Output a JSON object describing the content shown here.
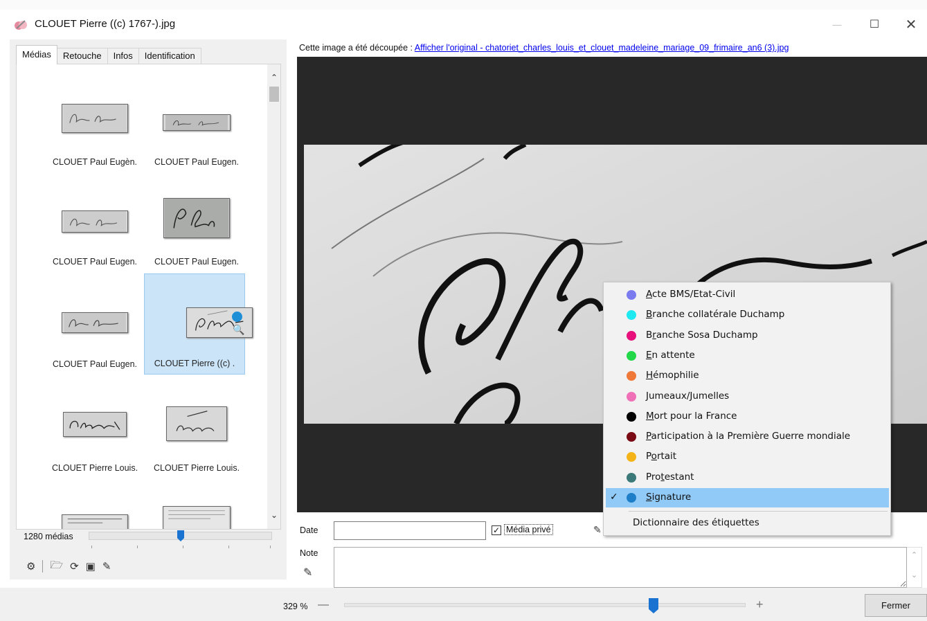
{
  "window": {
    "title": "CLOUET Pierre ((c) 1767-).jpg",
    "minimize_glyph": "—",
    "maximize_glyph": "☐",
    "close_glyph": "✕"
  },
  "tabs": [
    {
      "label": "Médias",
      "active": true
    },
    {
      "label": "Retouche",
      "active": false
    },
    {
      "label": "Infos",
      "active": false
    },
    {
      "label": "Identification",
      "active": false
    }
  ],
  "media_grid": {
    "items": [
      {
        "label": "CLOUET Paul Eugèn.",
        "selected": false
      },
      {
        "label": "CLOUET Paul Eugen.",
        "selected": false
      },
      {
        "label": "CLOUET Paul Eugen.",
        "selected": false
      },
      {
        "label": "CLOUET Paul Eugen.",
        "selected": false
      },
      {
        "label": "CLOUET Paul Eugen.",
        "selected": false
      },
      {
        "label": "CLOUET Pierre ((c) .",
        "selected": true
      },
      {
        "label": "CLOUET Pierre Louis.",
        "selected": false
      },
      {
        "label": "CLOUET Pierre Louis.",
        "selected": false
      }
    ],
    "selected_tag_color": "#1e8fd6"
  },
  "media_count": "1280 médias",
  "thumb_size_fraction": 0.5,
  "left_toolbar": {
    "icons": [
      "settings-icon",
      "folder-icon",
      "refresh-icon",
      "save-icon",
      "edit-icon"
    ]
  },
  "notice": {
    "prefix": "Cette image a été découpée : ",
    "link": "Afficher l'original - chatoriet_charles_louis_et_clouet_madeleine_mariage_09_frimaire_an6 (3).jpg"
  },
  "fields": {
    "date_label": "Date",
    "date_value": "",
    "private_label": "Média privé",
    "private_checked": true,
    "note_label": "Note",
    "note_value": ""
  },
  "context_menu": {
    "items": [
      {
        "label_rest": "cte BMS/Etat-Civil",
        "label_mn": "A",
        "label_pre": "",
        "color": "#7b7bf0",
        "checked": false
      },
      {
        "label_pre": "",
        "label_mn": "B",
        "label_rest": "ranche collatérale Duchamp",
        "color": "#1ee8f0",
        "checked": false
      },
      {
        "label_pre": "B",
        "label_mn": "r",
        "label_rest": "anche Sosa Duchamp",
        "color": "#e8107a",
        "checked": false
      },
      {
        "label_pre": "",
        "label_mn": "E",
        "label_rest": "n attente",
        "color": "#22d848",
        "checked": false
      },
      {
        "label_pre": "",
        "label_mn": "H",
        "label_rest": "émophilie",
        "color": "#f07838",
        "checked": false
      },
      {
        "label_pre": "",
        "label_mn": "J",
        "label_rest": "umeaux/Jumelles",
        "color": "#f070b8",
        "checked": false
      },
      {
        "label_pre": "",
        "label_mn": "M",
        "label_rest": "ort pour la France",
        "color": "#000000",
        "checked": false
      },
      {
        "label_pre": "",
        "label_mn": "P",
        "label_rest": "articipation à la Première Guerre mondiale",
        "color": "#7a0a14",
        "checked": false
      },
      {
        "label_pre": "P",
        "label_mn": "o",
        "label_rest": "rtait",
        "color": "#f4b418",
        "checked": false
      },
      {
        "label_pre": "Pro",
        "label_mn": "t",
        "label_rest": "estant",
        "color": "#3c7a7a",
        "checked": false
      },
      {
        "label_pre": "",
        "label_mn": "S",
        "label_rest": "ignature",
        "color": "#1e7fc8",
        "checked": true
      }
    ],
    "check_glyph": "✓",
    "dictionary": "Dictionnaire des étiquettes"
  },
  "zoom": {
    "label": "329 %",
    "minus": "—",
    "plus": "+",
    "fraction": 0.77
  },
  "close_button": "Fermer"
}
